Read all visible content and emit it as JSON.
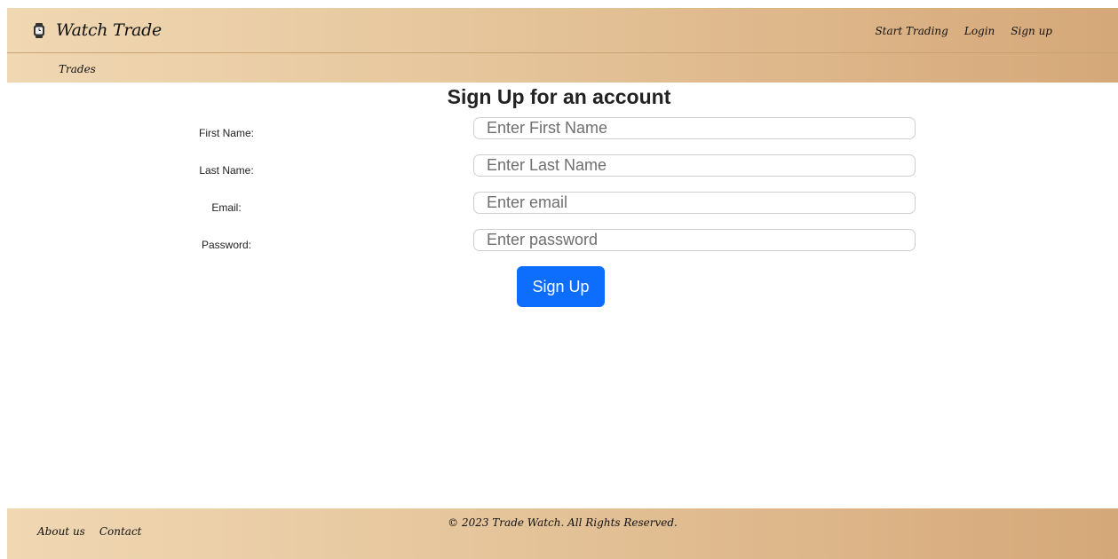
{
  "header": {
    "brand": "Watch Trade",
    "brand_icon": "watch-icon",
    "nav": {
      "start_trading": "Start Trading",
      "login": "Login",
      "signup": "Sign up"
    },
    "subnav": {
      "trades": "Trades"
    }
  },
  "form": {
    "title": "Sign Up for an account",
    "first_name": {
      "label": "First Name:",
      "placeholder": "Enter First Name"
    },
    "last_name": {
      "label": "Last Name:",
      "placeholder": "Enter Last Name"
    },
    "email": {
      "label": "Email:",
      "placeholder": "Enter email"
    },
    "password": {
      "label": "Password:",
      "placeholder": "Enter password"
    },
    "submit": "Sign Up"
  },
  "footer": {
    "about": "About us",
    "contact": "Contact",
    "copyright": "© 2023 Trade Watch. All Rights Reserved."
  },
  "colors": {
    "header_start": "#f0d8b3",
    "header_end": "#d5a879",
    "primary": "#0d6efd"
  }
}
